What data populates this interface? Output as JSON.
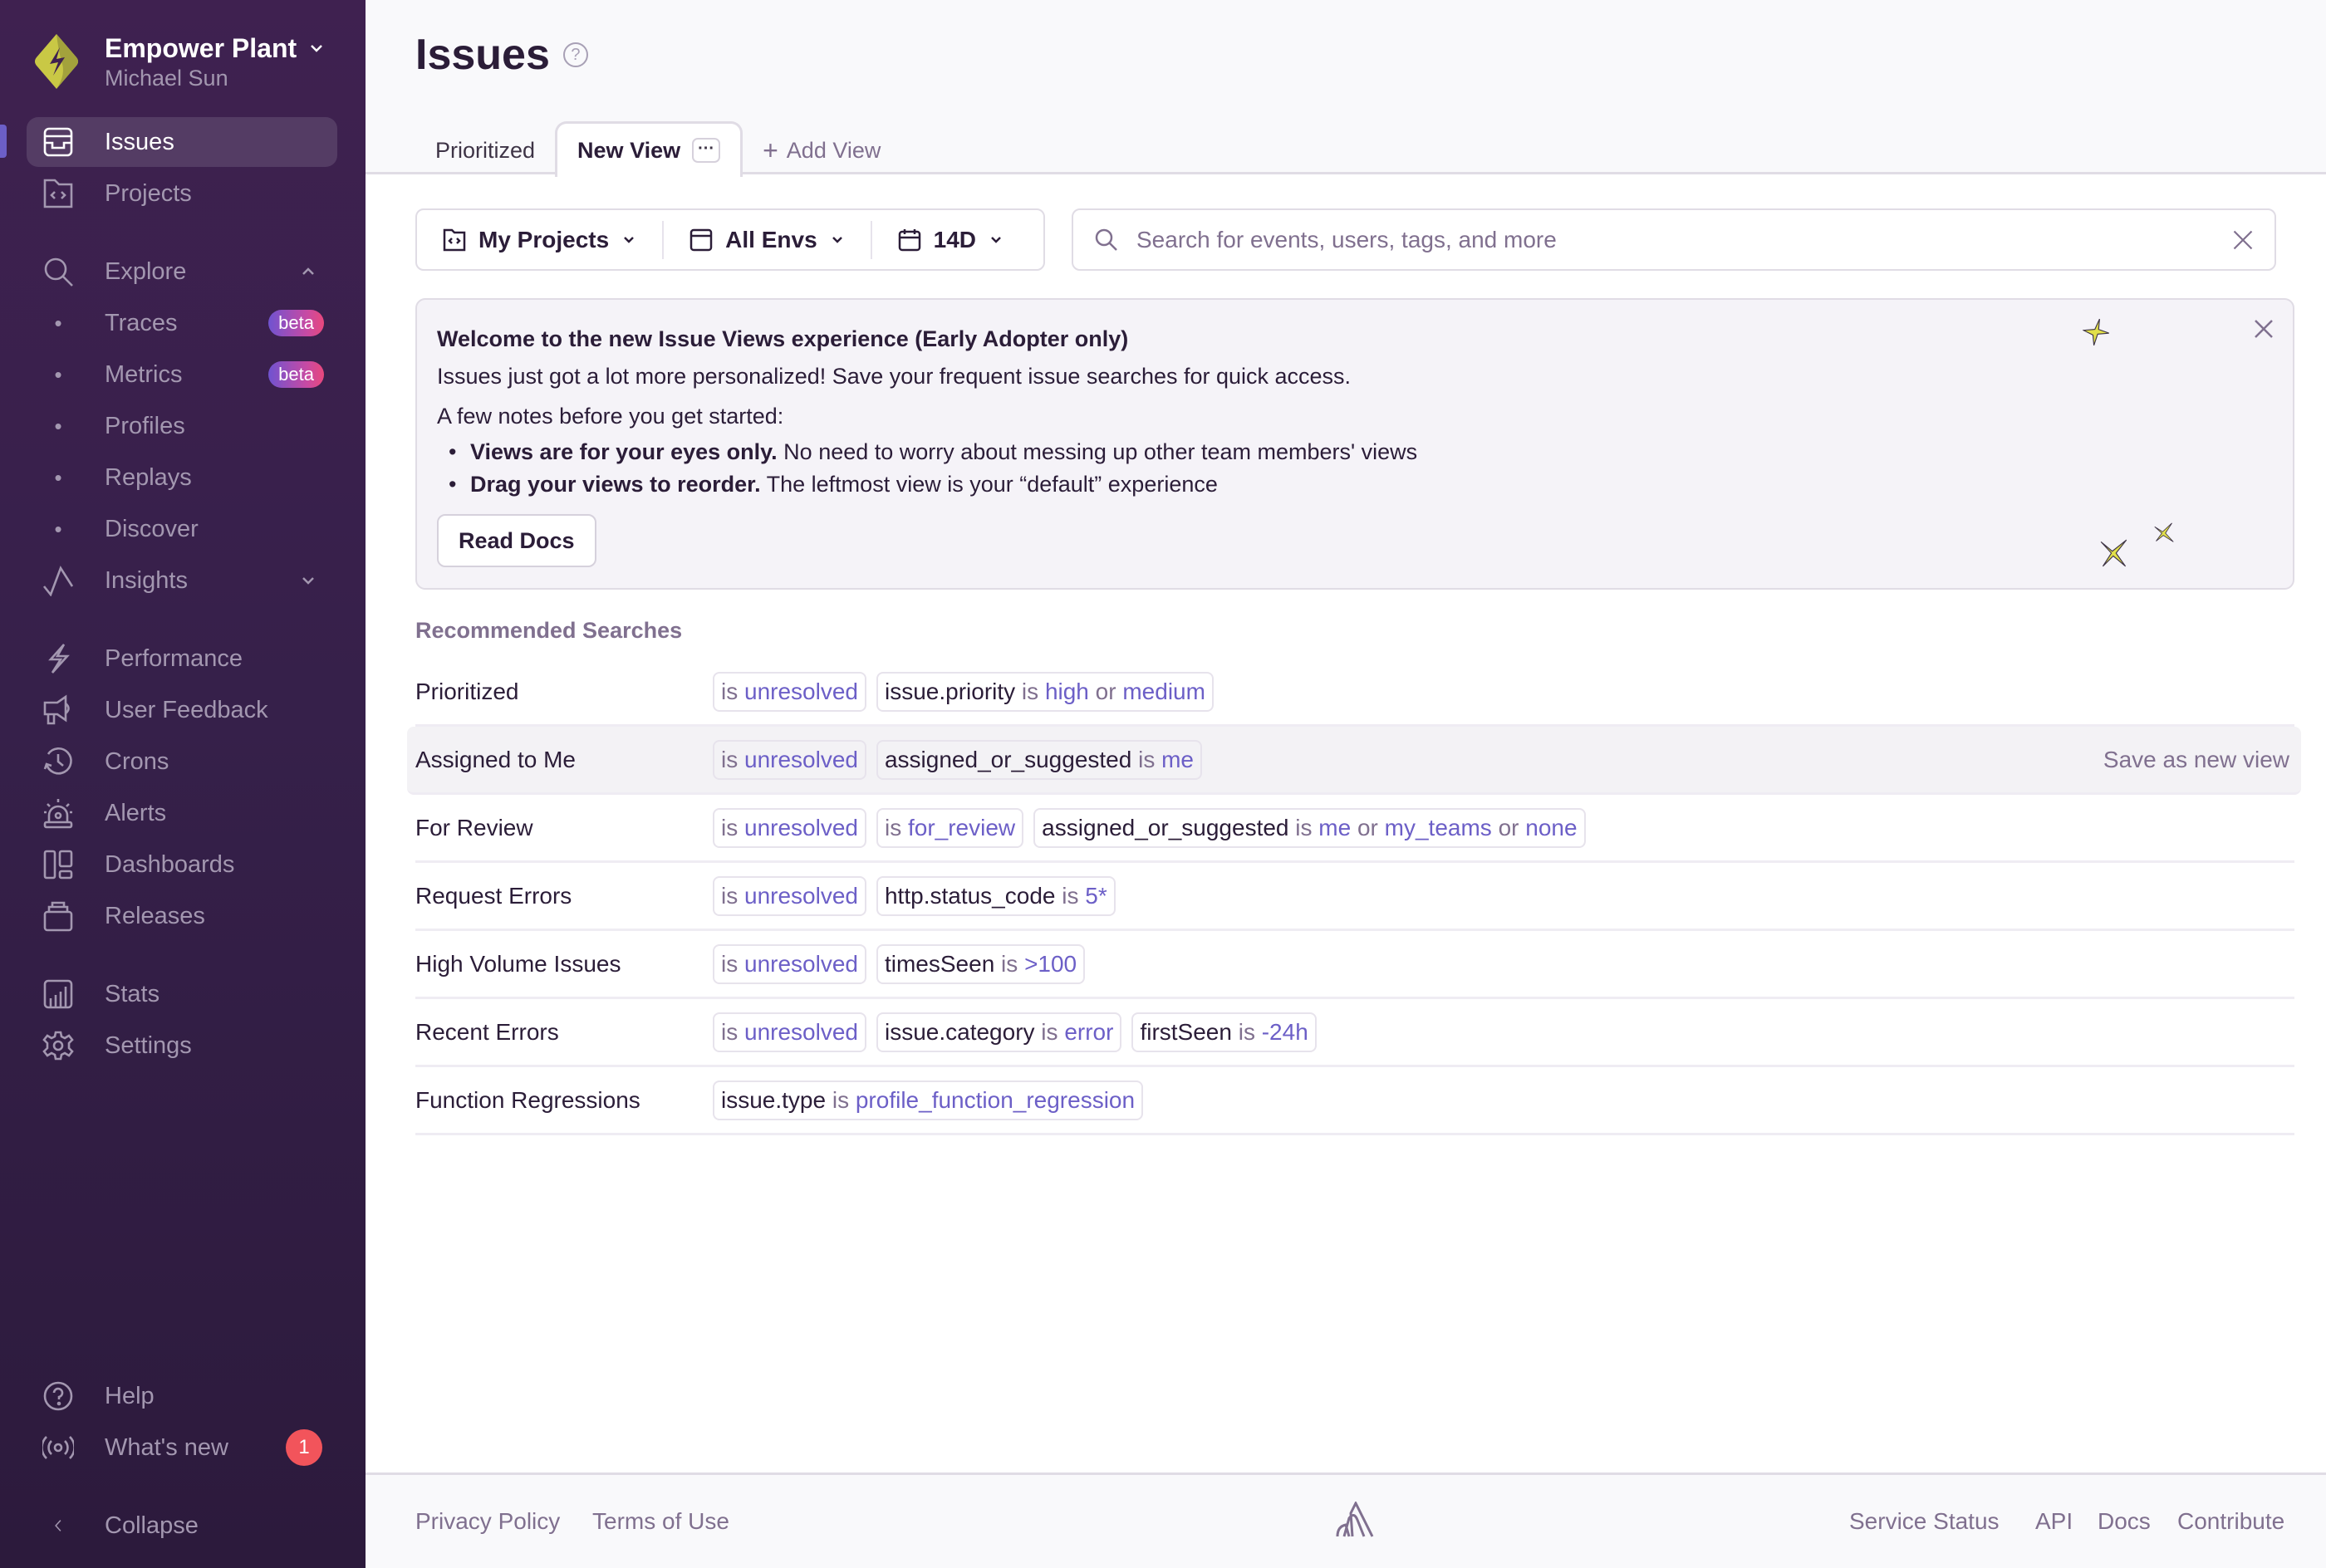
{
  "sidebar": {
    "org_name": "Empower Plant",
    "user_name": "Michael Sun",
    "items": [
      {
        "label": "Issues",
        "icon": "issues-inbox-icon",
        "active": true
      },
      {
        "label": "Projects",
        "icon": "projects-folder-icon"
      },
      {
        "label": "Explore",
        "icon": "search-icon",
        "expanded": true
      },
      {
        "label": "Traces",
        "badge": "beta"
      },
      {
        "label": "Metrics",
        "badge": "beta"
      },
      {
        "label": "Profiles"
      },
      {
        "label": "Replays"
      },
      {
        "label": "Discover"
      },
      {
        "label": "Insights",
        "icon": "insights-icon",
        "expanded": false
      },
      {
        "label": "Performance",
        "icon": "lightning-icon"
      },
      {
        "label": "User Feedback",
        "icon": "megaphone-icon"
      },
      {
        "label": "Crons",
        "icon": "clock-history-icon"
      },
      {
        "label": "Alerts",
        "icon": "siren-icon"
      },
      {
        "label": "Dashboards",
        "icon": "dashboard-icon"
      },
      {
        "label": "Releases",
        "icon": "releases-stack-icon"
      },
      {
        "label": "Stats",
        "icon": "stats-chart-icon"
      },
      {
        "label": "Settings",
        "icon": "gear-icon"
      },
      {
        "label": "Help",
        "icon": "help-circle-icon"
      },
      {
        "label": "What's new",
        "icon": "broadcast-icon",
        "count": "1"
      },
      {
        "label": "Collapse",
        "icon": "chevron-left-icon"
      }
    ]
  },
  "header": {
    "title": "Issues",
    "tabs": [
      {
        "label": "Prioritized"
      },
      {
        "label": "New View",
        "active": true
      },
      {
        "label": "Add View"
      }
    ],
    "tab_menu": "···"
  },
  "filters": {
    "projects": "My Projects",
    "envs": "All Envs",
    "date": "14D"
  },
  "search": {
    "placeholder": "Search for events, users, tags, and more",
    "value": ""
  },
  "banner": {
    "title": "Welcome to the new Issue Views experience (Early Adopter only)",
    "line1": "Issues just got a lot more personalized! Save your frequent issue searches for quick access.",
    "line2": "A few notes before you get started:",
    "bullets": [
      {
        "bold": "Views are for your eyes only.",
        "text": " No need to worry about messing up other team members' views"
      },
      {
        "bold": "Drag your views to reorder.",
        "text": " The leftmost view is your “default” experience"
      }
    ],
    "button": "Read Docs"
  },
  "recommended": {
    "title": "Recommended Searches",
    "save_label": "Save as new view",
    "rows": [
      {
        "label": "Prioritized",
        "tokens": [
          [
            [
              "op",
              "is "
            ],
            [
              "val",
              "unresolved"
            ]
          ],
          [
            [
              "key",
              "issue.priority"
            ],
            [
              "op",
              " is "
            ],
            [
              "val",
              "high"
            ],
            [
              "op",
              " or "
            ],
            [
              "val",
              "medium"
            ]
          ]
        ]
      },
      {
        "label": "Assigned to Me",
        "hover": true,
        "tokens": [
          [
            [
              "op",
              "is "
            ],
            [
              "val",
              "unresolved"
            ]
          ],
          [
            [
              "key",
              "assigned_or_suggested"
            ],
            [
              "op",
              " is "
            ],
            [
              "val",
              "me"
            ]
          ]
        ]
      },
      {
        "label": "For Review",
        "tokens": [
          [
            [
              "op",
              "is "
            ],
            [
              "val",
              "unresolved"
            ]
          ],
          [
            [
              "op",
              "is "
            ],
            [
              "val",
              "for_review"
            ]
          ],
          [
            [
              "key",
              "assigned_or_suggested"
            ],
            [
              "op",
              " is "
            ],
            [
              "val",
              "me"
            ],
            [
              "op",
              " or "
            ],
            [
              "val",
              "my_teams"
            ],
            [
              "op",
              " or "
            ],
            [
              "val",
              "none"
            ]
          ]
        ]
      },
      {
        "label": "Request Errors",
        "tokens": [
          [
            [
              "op",
              "is "
            ],
            [
              "val",
              "unresolved"
            ]
          ],
          [
            [
              "key",
              "http.status_code"
            ],
            [
              "op",
              " is "
            ],
            [
              "val",
              "5*"
            ]
          ]
        ]
      },
      {
        "label": "High Volume Issues",
        "tokens": [
          [
            [
              "op",
              "is "
            ],
            [
              "val",
              "unresolved"
            ]
          ],
          [
            [
              "key",
              "timesSeen"
            ],
            [
              "op",
              " is "
            ],
            [
              "val",
              ">100"
            ]
          ]
        ]
      },
      {
        "label": "Recent Errors",
        "tokens": [
          [
            [
              "op",
              "is "
            ],
            [
              "val",
              "unresolved"
            ]
          ],
          [
            [
              "key",
              "issue.category"
            ],
            [
              "op",
              " is "
            ],
            [
              "val",
              "error"
            ]
          ],
          [
            [
              "key",
              "firstSeen"
            ],
            [
              "op",
              " is "
            ],
            [
              "val",
              "-24h"
            ]
          ]
        ]
      },
      {
        "label": "Function Regressions",
        "tokens": [
          [
            [
              "key",
              "issue.type"
            ],
            [
              "op",
              " is "
            ],
            [
              "val",
              "profile_function_regression"
            ]
          ]
        ]
      }
    ]
  },
  "footer": {
    "privacy": "Privacy Policy",
    "terms": "Terms of Use",
    "service_status": "Service Status",
    "api": "API",
    "docs": "Docs",
    "contribute": "Contribute"
  },
  "colors": {
    "sidebar_bg": "#3f2150",
    "accent": "#6c5fc7",
    "badge_red": "#f2545b",
    "brand_yellow": "#d4d44a"
  }
}
